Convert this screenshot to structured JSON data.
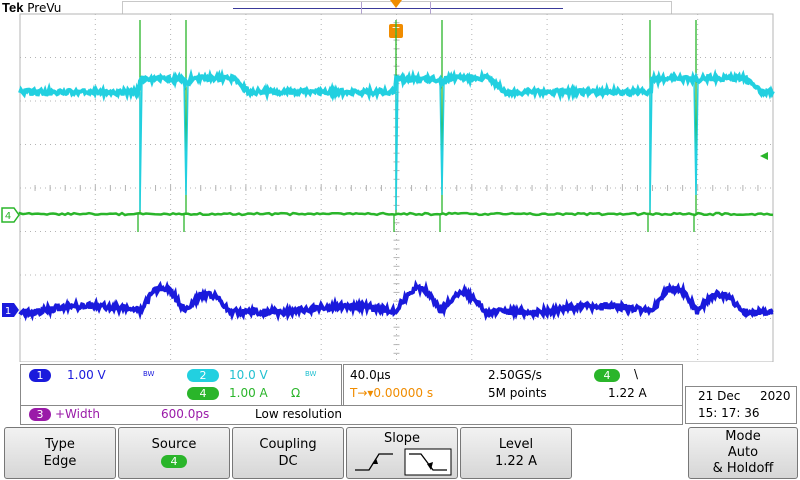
{
  "brand": {
    "name": "Tek",
    "mode": "PreVu"
  },
  "colors": {
    "ch1": "#1a1adc",
    "ch2": "#22d0e0",
    "ch4": "#2ab52a",
    "math": "#9a1aa8",
    "trigger": "#f08c00",
    "grid": "#b4b4b4"
  },
  "trigger_marker": "T",
  "markers": {
    "ch4": "4",
    "ch1": "1"
  },
  "channels": {
    "ch1": {
      "num": "1",
      "scale": "1.00 V",
      "bw": "BW"
    },
    "ch2": {
      "num": "2",
      "scale": "10.0 V",
      "bw": "BW"
    },
    "ch4": {
      "num": "4",
      "scale": "1.00 A",
      "term": "Ω"
    }
  },
  "timebase": {
    "scale": "40.0μs",
    "sample_rate": "2.50GS/s",
    "record": "5M points",
    "trig_pos": "T→▾0.00000 s"
  },
  "trigger": {
    "source": "4",
    "slope_symbol": "\\",
    "level": "1.22 A"
  },
  "measurement": {
    "num": "3",
    "label": "+Width",
    "value": "600.0ps",
    "status": "Low resolution"
  },
  "datetime": {
    "date": "21 Dec",
    "year": "2020",
    "time": "15: 17: 36"
  },
  "softkeys": {
    "type": {
      "label": "Type",
      "value": "Edge"
    },
    "source": {
      "label": "Source",
      "value": "4"
    },
    "coupling": {
      "label": "Coupling",
      "value": "DC"
    },
    "slope": {
      "label": "Slope"
    },
    "level": {
      "label": "Level",
      "value": "1.22 A"
    },
    "mode": {
      "label": "Mode",
      "value1": "Auto",
      "value2": "& Holdoff"
    }
  }
}
